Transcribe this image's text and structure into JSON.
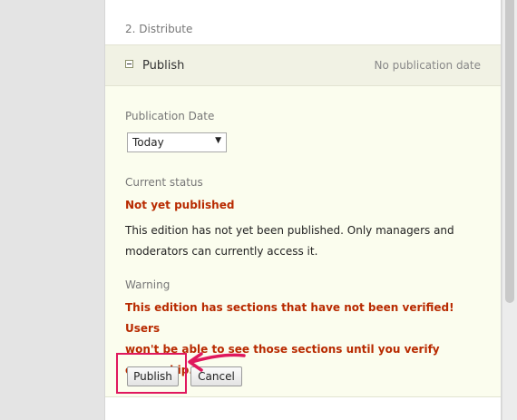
{
  "step": {
    "title": "2. Distribute"
  },
  "section": {
    "label": "Publish",
    "meta": "No publication date"
  },
  "publication_date": {
    "label": "Publication Date",
    "selected": "Today"
  },
  "status": {
    "label": "Current status",
    "value": "Not yet published",
    "lines": [
      "This edition has not yet been published. Only managers and",
      "moderators can currently access it."
    ]
  },
  "warning": {
    "label": "Warning",
    "lines": [
      "This edition has sections that have not been verified! Users",
      "won't be able to see those sections until you verify ownership."
    ]
  },
  "actions": {
    "publish_label": "Publish",
    "cancel_label": "Cancel"
  },
  "colors": {
    "alert": "#b82a00",
    "highlight": "#e0185e",
    "section_bg": "#fbfdee"
  }
}
